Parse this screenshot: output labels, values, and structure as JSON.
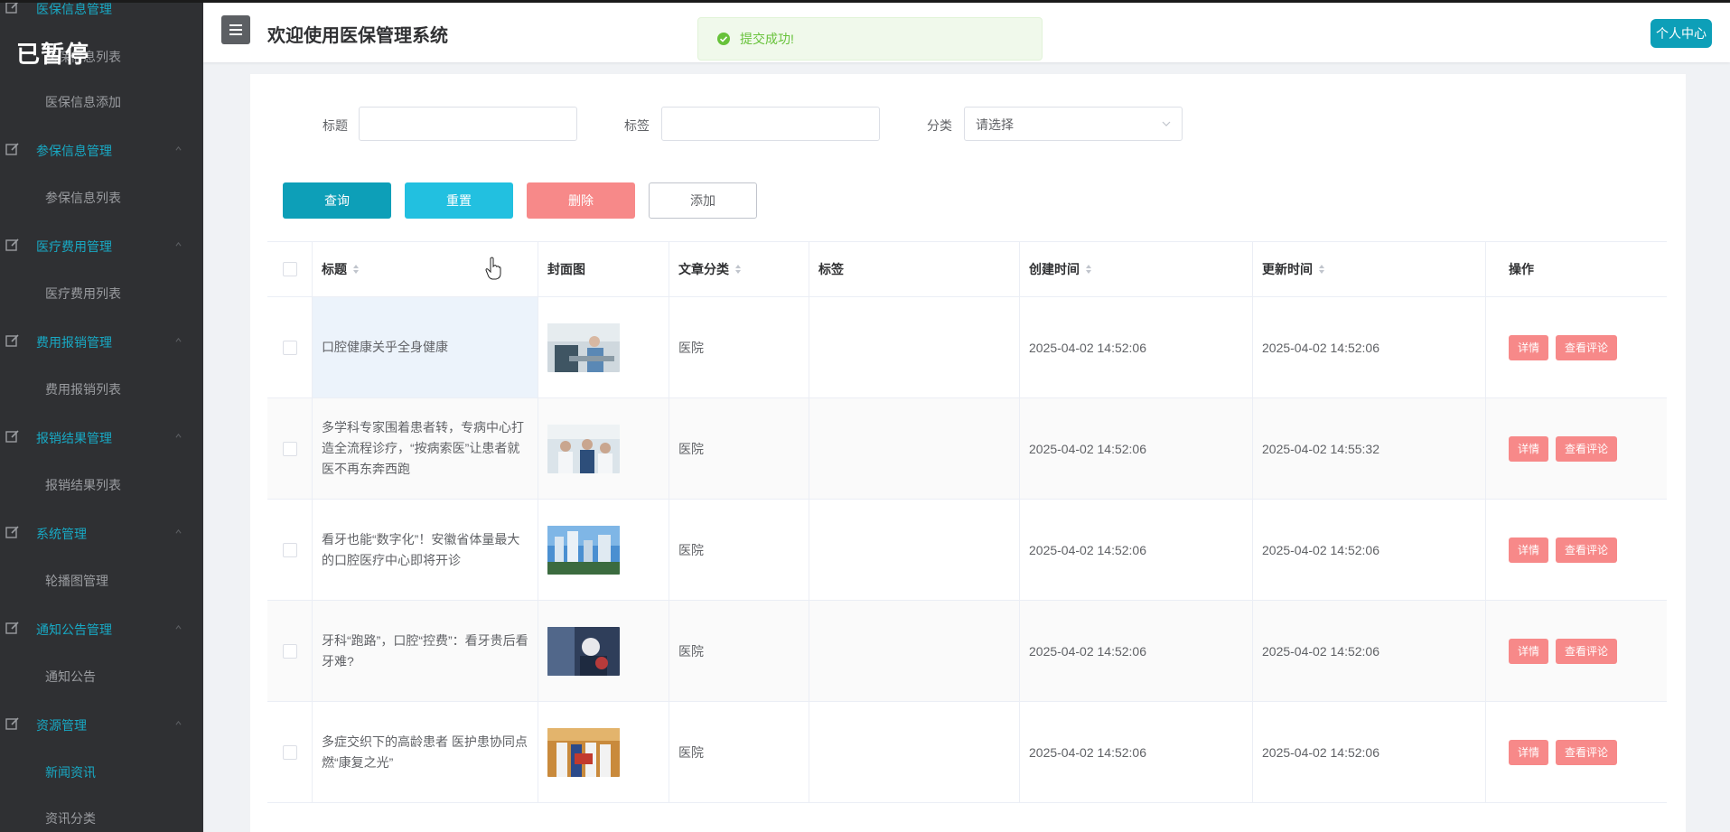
{
  "overlay": {
    "paused_label": "已暂停"
  },
  "sidebar": {
    "groups": [
      {
        "label": "医保信息管理",
        "subitems": [
          "医保信息列表",
          "医保信息添加"
        ]
      },
      {
        "label": "参保信息管理",
        "subitems": [
          "参保信息列表"
        ]
      },
      {
        "label": "医疗费用管理",
        "subitems": [
          "医疗费用列表"
        ]
      },
      {
        "label": "费用报销管理",
        "subitems": [
          "费用报销列表"
        ]
      },
      {
        "label": "报销结果管理",
        "subitems": [
          "报销结果列表"
        ]
      },
      {
        "label": "系统管理",
        "subitems": [
          "轮播图管理"
        ]
      },
      {
        "label": "通知公告管理",
        "subitems": [
          "通知公告"
        ]
      },
      {
        "label": "资源管理",
        "subitems": [
          "新闻资讯",
          "资讯分类"
        ]
      }
    ],
    "active_item": "新闻资讯",
    "accent_color": "#18a9c4",
    "background": "#2f3033"
  },
  "header": {
    "menu_toggle": "≡",
    "title": "欢迎使用医保管理系统",
    "profile_button": "个人中心"
  },
  "toast": {
    "message": "提交成功!",
    "type": "success"
  },
  "filters": {
    "title_label": "标题",
    "title_value": "",
    "tag_label": "标签",
    "tag_value": "",
    "category_label": "分类",
    "category_placeholder": "请选择"
  },
  "actions": {
    "query": "查询",
    "reset": "重置",
    "delete": "删除",
    "add": "添加"
  },
  "table": {
    "columns": [
      "标题",
      "封面图",
      "文章分类",
      "标签",
      "创建时间",
      "更新时间",
      "操作"
    ],
    "rows": [
      {
        "title": "口腔健康关乎全身健康",
        "category": "医院",
        "tag": "",
        "created": "2025-04-02 14:52:06",
        "updated": "2025-04-02 14:52:06"
      },
      {
        "title": "多学科专家围着患者转，专病中心打造全流程诊疗，“按病索医”让患者就医不再东奔西跑",
        "category": "医院",
        "tag": "",
        "created": "2025-04-02 14:52:06",
        "updated": "2025-04-02 14:55:32"
      },
      {
        "title": "看牙也能“数字化”！安徽省体量最大的口腔医疗中心即将开诊",
        "category": "医院",
        "tag": "",
        "created": "2025-04-02 14:52:06",
        "updated": "2025-04-02 14:52:06"
      },
      {
        "title": "牙科“跑路”，口腔“控费”：看牙贵后看牙难?",
        "category": "医院",
        "tag": "",
        "created": "2025-04-02 14:52:06",
        "updated": "2025-04-02 14:52:06"
      },
      {
        "title": "多症交织下的高龄患者 医护患协同点燃“康复之光”",
        "category": "医院",
        "tag": "",
        "created": "2025-04-02 14:52:06",
        "updated": "2025-04-02 14:52:06"
      }
    ],
    "row_actions": {
      "detail": "详情",
      "comments": "查看评论"
    }
  }
}
